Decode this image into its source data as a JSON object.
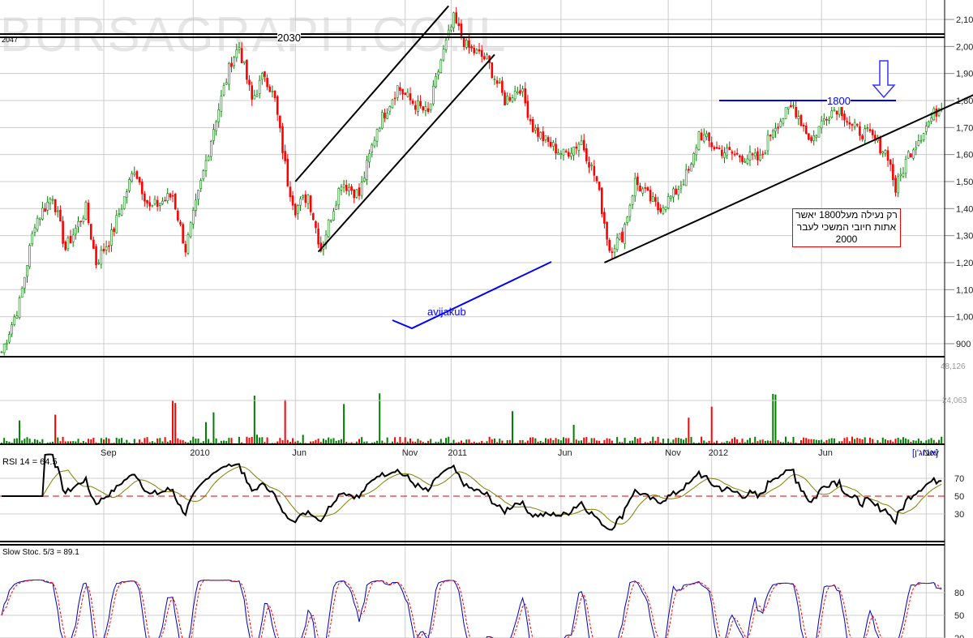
{
  "watermark": "BURSAGRAPH.CO.IL",
  "labels": {
    "level_left": "2047",
    "level_2030": "2030",
    "level_1800": "1800",
    "signature": "avijakub",
    "note": "רק נעילה מעל1800 יאשר אתות חיובי המשכי לעבר 2000",
    "volume_max": "48,126",
    "volume_mid": "24,063",
    "period": "[אבוג'ן]",
    "rsi": "RSI 14 = 64.5",
    "stoch": "Slow Stoc. 5/3 = 89.1"
  },
  "colors": {
    "up": "#008000",
    "down": "#ff0000",
    "trend": "#000000",
    "level": "#0000ff",
    "rsi": "#000000",
    "rsi_ma": "#808000",
    "stoch_k": "#0000c0",
    "stoch_d": "#ff0000"
  },
  "chart_data": {
    "type": "candlestick",
    "price_axis": {
      "range": [
        870,
        2130
      ],
      "ticks": [
        900,
        1000,
        1100,
        1200,
        1300,
        1400,
        1500,
        1600,
        1700,
        1800,
        1900,
        2000,
        2100
      ],
      "tick_labels": [
        "900",
        "1,000",
        "1,100",
        "1,200",
        "1,300",
        "1,400",
        "1,500",
        "1,600",
        "1,700",
        "1,800",
        "1,900",
        "2,000",
        "2,100"
      ]
    },
    "x_ticks": [
      {
        "bar": 40,
        "label": "Sep"
      },
      {
        "bar": 75,
        "label": "2010"
      },
      {
        "bar": 115,
        "label": "Jun"
      },
      {
        "bar": 158,
        "label": "Nov"
      },
      {
        "bar": 176,
        "label": "2011"
      },
      {
        "bar": 219,
        "label": "Jun"
      },
      {
        "bar": 261,
        "label": "Nov"
      },
      {
        "bar": 278,
        "label": "2012"
      },
      {
        "bar": 321,
        "label": "Jun"
      },
      {
        "bar": 362,
        "label": "Nov"
      }
    ],
    "close_keypoints": [
      [
        0,
        870
      ],
      [
        7,
        1050
      ],
      [
        13,
        1350
      ],
      [
        20,
        1450
      ],
      [
        25,
        1250
      ],
      [
        33,
        1400
      ],
      [
        37,
        1200
      ],
      [
        43,
        1300
      ],
      [
        52,
        1550
      ],
      [
        58,
        1400
      ],
      [
        67,
        1450
      ],
      [
        72,
        1250
      ],
      [
        77,
        1450
      ],
      [
        83,
        1700
      ],
      [
        90,
        1950
      ],
      [
        93,
        2000
      ],
      [
        98,
        1800
      ],
      [
        103,
        1900
      ],
      [
        107,
        1800
      ],
      [
        112,
        1500
      ],
      [
        115,
        1400
      ],
      [
        120,
        1450
      ],
      [
        125,
        1250
      ],
      [
        133,
        1500
      ],
      [
        140,
        1450
      ],
      [
        147,
        1700
      ],
      [
        155,
        1850
      ],
      [
        160,
        1800
      ],
      [
        167,
        1750
      ],
      [
        172,
        1950
      ],
      [
        177,
        2100
      ],
      [
        182,
        2000
      ],
      [
        190,
        1950
      ],
      [
        197,
        1800
      ],
      [
        203,
        1850
      ],
      [
        208,
        1700
      ],
      [
        213,
        1650
      ],
      [
        220,
        1600
      ],
      [
        227,
        1650
      ],
      [
        233,
        1500
      ],
      [
        238,
        1250
      ],
      [
        243,
        1300
      ],
      [
        248,
        1500
      ],
      [
        257,
        1400
      ],
      [
        263,
        1450
      ],
      [
        270,
        1550
      ],
      [
        273,
        1680
      ],
      [
        280,
        1620
      ],
      [
        287,
        1600
      ],
      [
        297,
        1580
      ],
      [
        302,
        1700
      ],
      [
        310,
        1780
      ],
      [
        317,
        1650
      ],
      [
        323,
        1750
      ],
      [
        328,
        1780
      ],
      [
        333,
        1700
      ],
      [
        340,
        1670
      ],
      [
        347,
        1600
      ],
      [
        350,
        1470
      ],
      [
        355,
        1600
      ],
      [
        363,
        1720
      ],
      [
        368,
        1790
      ]
    ],
    "volume_axis": {
      "max": 48126,
      "mid": 24063
    },
    "rsi": {
      "period": 14,
      "last": 64.5,
      "levels": [
        30,
        50,
        70
      ]
    },
    "stoch": {
      "k": 5,
      "d": 3,
      "last": 89.1,
      "levels": [
        20,
        50,
        80
      ]
    },
    "horizontal_levels": [
      2047,
      2030,
      1800
    ],
    "trendlines": [
      [
        [
          115,
          1500
        ],
        [
          175,
          2150
        ]
      ],
      [
        [
          124,
          1240
        ],
        [
          193,
          1970
        ]
      ],
      [
        [
          236,
          1200
        ],
        [
          392,
          1870
        ]
      ]
    ]
  }
}
